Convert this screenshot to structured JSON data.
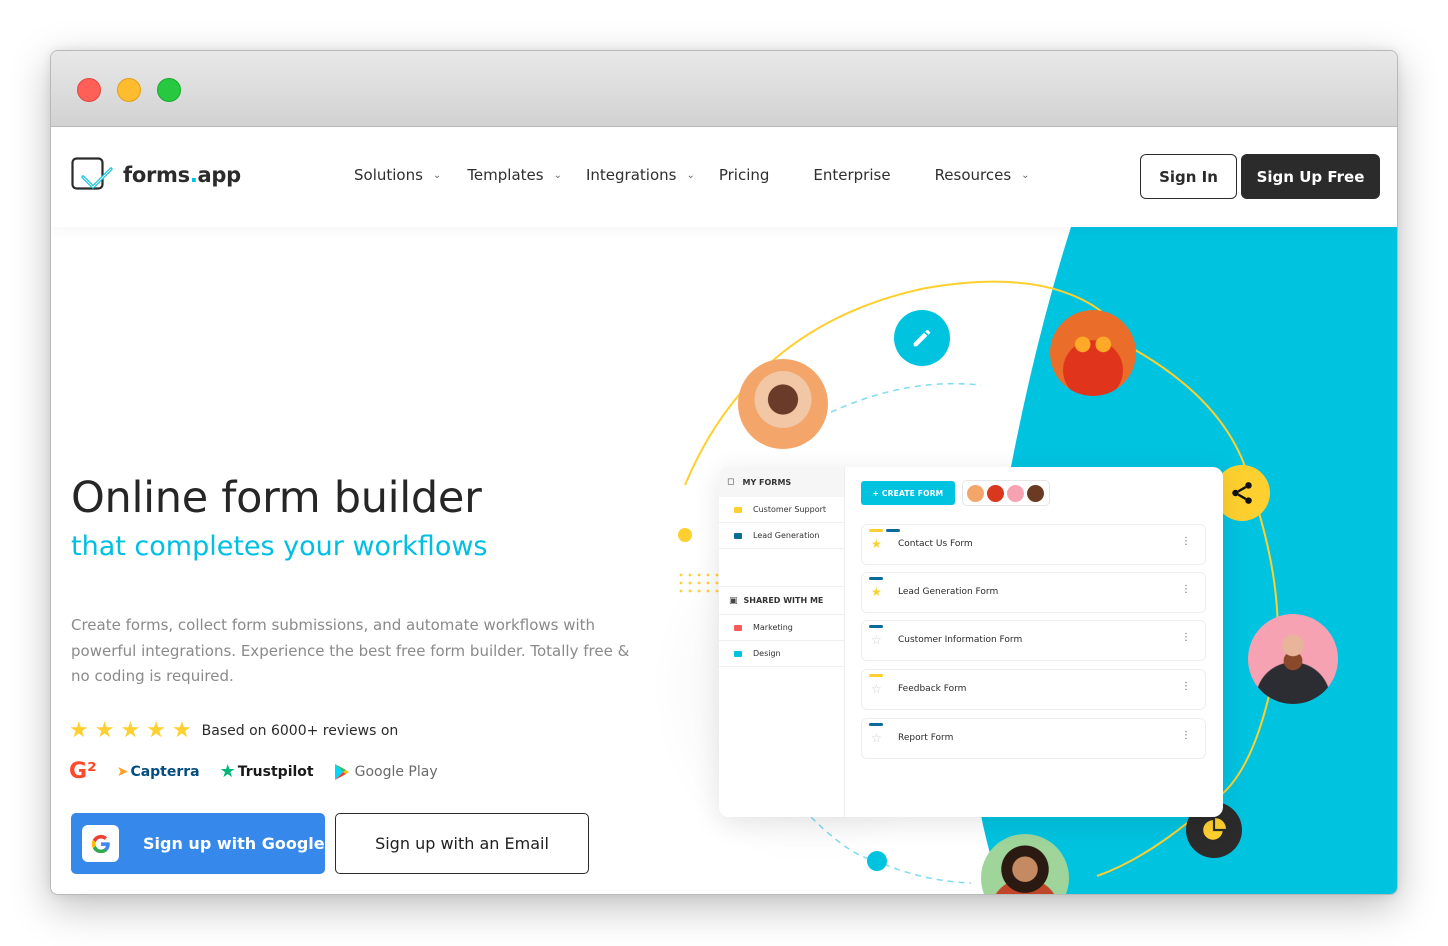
{
  "window": {
    "controls": [
      "close",
      "minimize",
      "maximize"
    ]
  },
  "header": {
    "logo": {
      "text_main": "forms",
      "text_dot": ".",
      "text_tail": "app",
      "icon": "checkmark-frame-icon"
    },
    "nav": [
      {
        "label": "Solutions",
        "dropdown": true
      },
      {
        "label": "Templates",
        "dropdown": true
      },
      {
        "label": "Integrations",
        "dropdown": true
      },
      {
        "label": "Pricing",
        "dropdown": false
      },
      {
        "label": "Enterprise",
        "dropdown": false
      },
      {
        "label": "Resources",
        "dropdown": true
      }
    ],
    "sign_in": "Sign In",
    "sign_up": "Sign Up Free"
  },
  "hero": {
    "title": "Online form builder",
    "subtitle": "that completes your workflows",
    "description": "Create forms, collect form submissions, and automate workflows with powerful integrations. Experience the best free form builder. Totally free & no coding is required.",
    "rating": {
      "stars": 5,
      "max_stars": 5,
      "text": "Based on 6000+ reviews on"
    },
    "platforms": [
      {
        "name": "G2",
        "label": "G²"
      },
      {
        "name": "Capterra",
        "label": "Capterra"
      },
      {
        "name": "Trustpilot",
        "label": "Trustpilot"
      },
      {
        "name": "Google Play",
        "label": "Google Play"
      }
    ],
    "google_button": "Sign up with Google",
    "email_button": "Sign up with an Email"
  },
  "illustration": {
    "sidebar": {
      "my_forms": "MY FORMS",
      "my_folders": [
        {
          "label": "Customer Support",
          "color": "#fed02f"
        },
        {
          "label": "Lead Generation",
          "color": "#0a6b9a"
        }
      ],
      "shared": "SHARED WITH ME",
      "shared_folders": [
        {
          "label": "Marketing",
          "color": "#f25c5c"
        },
        {
          "label": "Design",
          "color": "#00c3e0"
        }
      ]
    },
    "create_form": "+ CREATE FORM",
    "forms": [
      {
        "name": "Contact Us Form",
        "starred": true,
        "tags": [
          "#fed02f",
          "#0a6b9a"
        ]
      },
      {
        "name": "Lead Generation Form",
        "starred": true,
        "tags": [
          "#0a6b9a"
        ]
      },
      {
        "name": "Customer Information Form",
        "starred": false,
        "tags": [
          "#0a6b9a"
        ]
      },
      {
        "name": "Feedback Form",
        "starred": false,
        "tags": [
          "#fed02f"
        ]
      },
      {
        "name": "Report Form",
        "starred": false,
        "tags": [
          "#0a6b9a"
        ]
      }
    ]
  },
  "colors": {
    "accent": "#00c3e0",
    "yellow": "#fed02f",
    "dark": "#2b2b2b",
    "google_blue": "#3689ea"
  }
}
